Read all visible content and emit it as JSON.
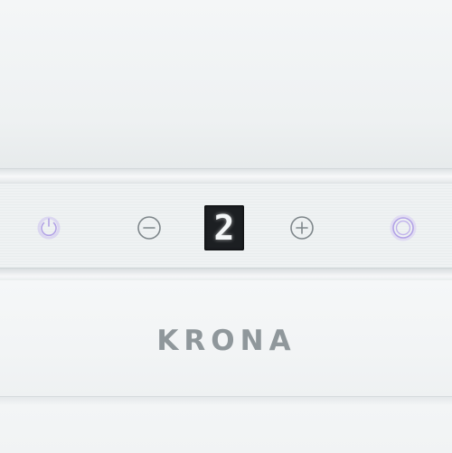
{
  "controls": {
    "power": {
      "icon": "power-icon"
    },
    "minus": {
      "icon": "minus-circle-icon"
    },
    "plus": {
      "icon": "plus-circle-icon"
    },
    "light": {
      "icon": "light-icon"
    }
  },
  "display": {
    "value": "2"
  },
  "brand": {
    "logo_text": "KRONA"
  },
  "colors": {
    "accent_glow": "#b9a8ea",
    "panel": "#eef1f2",
    "logo": "#8f979b",
    "display_bg": "#1c1f22"
  }
}
